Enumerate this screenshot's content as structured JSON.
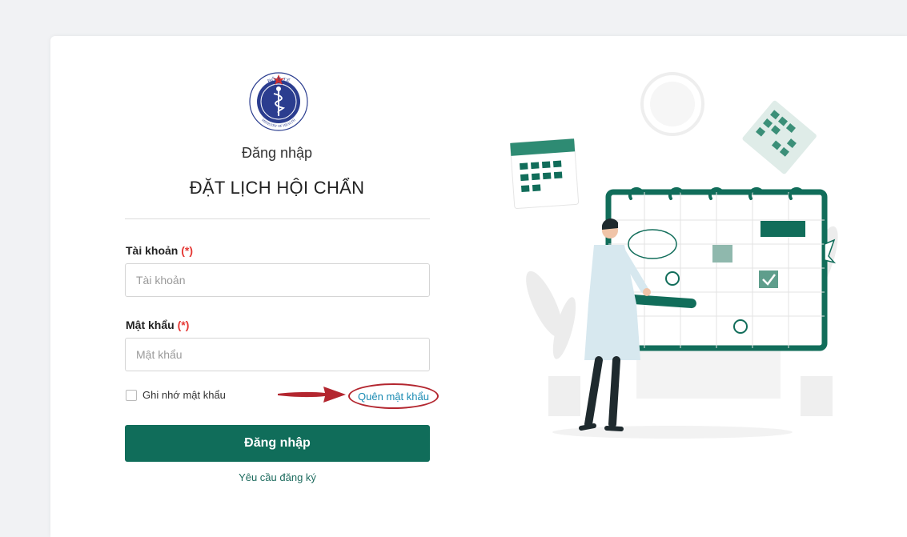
{
  "header": {
    "subtitle": "Đăng nhập",
    "title": "ĐẶT LỊCH HỘI CHẨN",
    "logo": {
      "top_text": "BỘ Y TẾ",
      "bottom_text": "MINISTRY OF HEALTH",
      "icon": "caduceus-icon"
    }
  },
  "form": {
    "username": {
      "label": "Tài khoản",
      "required_mark": "(*)",
      "placeholder": "Tài khoản",
      "value": ""
    },
    "password": {
      "label": "Mật khẩu",
      "required_mark": "(*)",
      "placeholder": "Mật khẩu",
      "value": ""
    },
    "remember": {
      "label": "Ghi nhớ mật khẩu",
      "checked": false
    },
    "forgot_link": "Quên mật khẩu",
    "submit_label": "Đăng nhập",
    "register_link": "Yêu cầu đăng ký"
  },
  "colors": {
    "primary": "#106d5a",
    "required": "#e53935",
    "link": "#1a8bb3",
    "highlight": "#b3262f"
  }
}
